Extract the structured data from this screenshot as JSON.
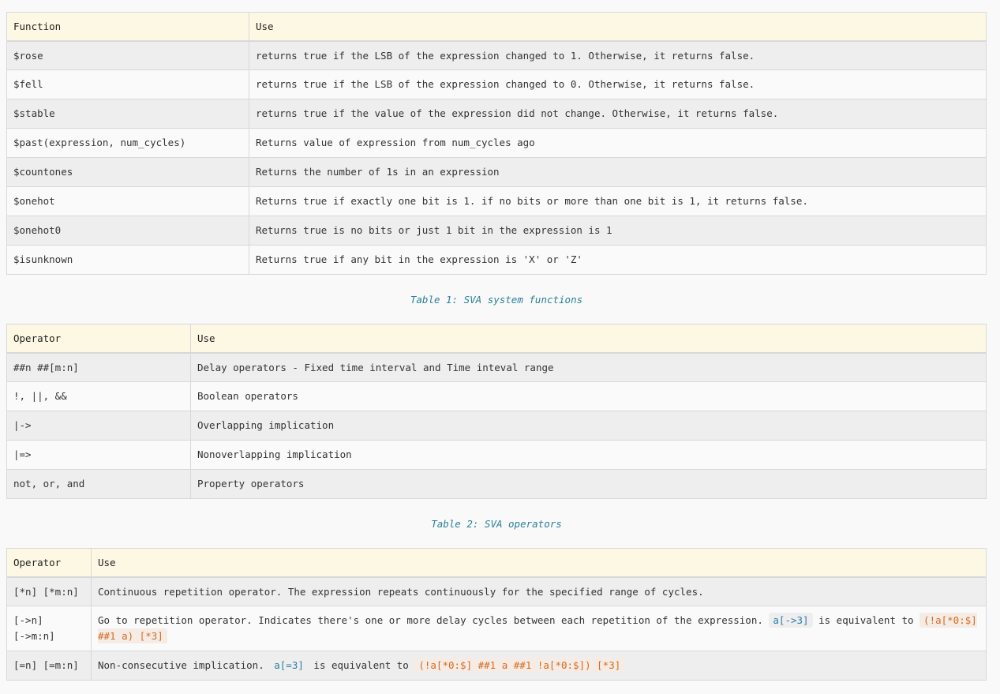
{
  "table1": {
    "headers": [
      "Function",
      "Use"
    ],
    "rows": [
      [
        "$rose",
        "returns true if the LSB of the expression changed to 1. Otherwise, it returns false."
      ],
      [
        "$fell",
        "returns true if the LSB of the expression changed to 0. Otherwise, it returns false."
      ],
      [
        "$stable",
        "returns true if the value of the expression did not change. Otherwise, it returns false."
      ],
      [
        "$past(expression, num_cycles)",
        "Returns value of expression from num_cycles ago"
      ],
      [
        "$countones",
        "Returns the number of 1s in an expression"
      ],
      [
        "$onehot",
        "Returns true if exactly one bit is 1. if no bits or more than one bit is 1, it returns false."
      ],
      [
        "$onehot0",
        "Returns true is no bits or just 1 bit in the expression is 1"
      ],
      [
        "$isunknown",
        "Returns true if any bit in the expression is 'X' or 'Z'"
      ]
    ],
    "caption": "Table 1: SVA system functions"
  },
  "table2": {
    "headers": [
      "Operator",
      "Use"
    ],
    "rows": [
      [
        "##n ##[m:n]",
        "Delay operators - Fixed time interval and Time inteval range"
      ],
      [
        "!, ||, &&",
        "Boolean operators"
      ],
      [
        "|->",
        "Overlapping implication"
      ],
      [
        "|=>",
        "Nonoverlapping implication"
      ],
      [
        "not, or, and",
        "Property operators"
      ]
    ],
    "caption": "Table 2: SVA operators"
  },
  "table3": {
    "headers": [
      "Operator",
      "Use"
    ],
    "row1": {
      "op": "[*n] [*m:n]",
      "use": "Continuous repetition operator. The expression repeats continuously for the specified range of cycles."
    },
    "row2": {
      "op_line1": "[->n]",
      "op_line2": "[->m:n]",
      "use_text": "Go to repetition operator. Indicates there's one or more delay cycles between each repetition of the expression.",
      "code1": "a[->3]",
      "middle": "is equivalent to",
      "code2": "(!a[*0:$] ##1 a) [*3]"
    },
    "row3": {
      "op": "[=n] [=m:n]",
      "use_text": "Non-consecutive implication.",
      "code1": "a[=3]",
      "middle": "is equivalent to",
      "code2": "(!a[*0:$] ##1 a ##1 !a[*0:$]) [*3]"
    }
  }
}
